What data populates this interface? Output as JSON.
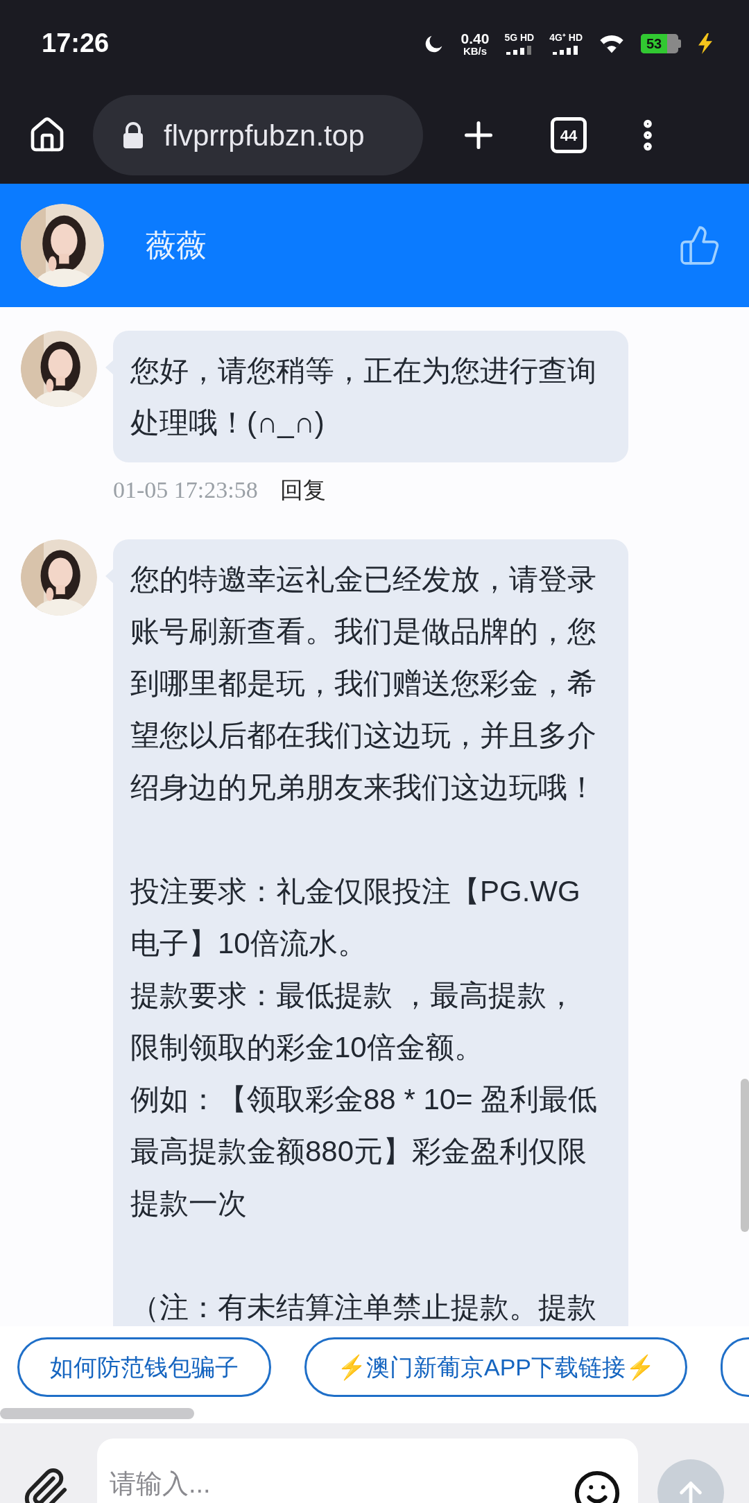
{
  "status_bar": {
    "time": "17:26",
    "speed_value": "0.40",
    "speed_unit": "KB/s",
    "sim_1": "5G HD",
    "sim_2": "4G⁺ HD",
    "battery": "53"
  },
  "browser": {
    "url": "flvprrpfubzn.top",
    "tab_count": "44"
  },
  "chat_header": {
    "name": "薇薇"
  },
  "messages": [
    {
      "sections": [
        [
          "您好，请您稍等，正在为您进行查询处理哦！(∩_∩)"
        ]
      ],
      "timestamp": "01-05 17:23:58",
      "reply_label": "回复"
    },
    {
      "sections": [
        [
          "您的特邀幸运礼金已经发放，请登录账号刷新查看。我们是做品牌的，您到哪里都是玩，我们赠送您彩金，希望您以后都在我们这边玩，并且多介绍身边的兄弟朋友来我们这边玩哦！"
        ],
        [
          "投注要求：礼金仅限投注【PG.WG电子】10倍流水。",
          "提款要求：最低提款 ，最高提款，限制领取的彩金10倍金额。",
          "例如：【领取彩金88 * 10= 盈利最低最高提款金额880元】彩金盈利仅限提款一次"
        ],
        [
          "（注：有未结算注单禁止提款。提款"
        ]
      ]
    }
  ],
  "quick_replies": [
    {
      "label": "如何防范钱包骗子"
    },
    {
      "label": "⚡澳门新葡京APP下载链接⚡"
    }
  ],
  "input": {
    "placeholder": "请输入..."
  }
}
